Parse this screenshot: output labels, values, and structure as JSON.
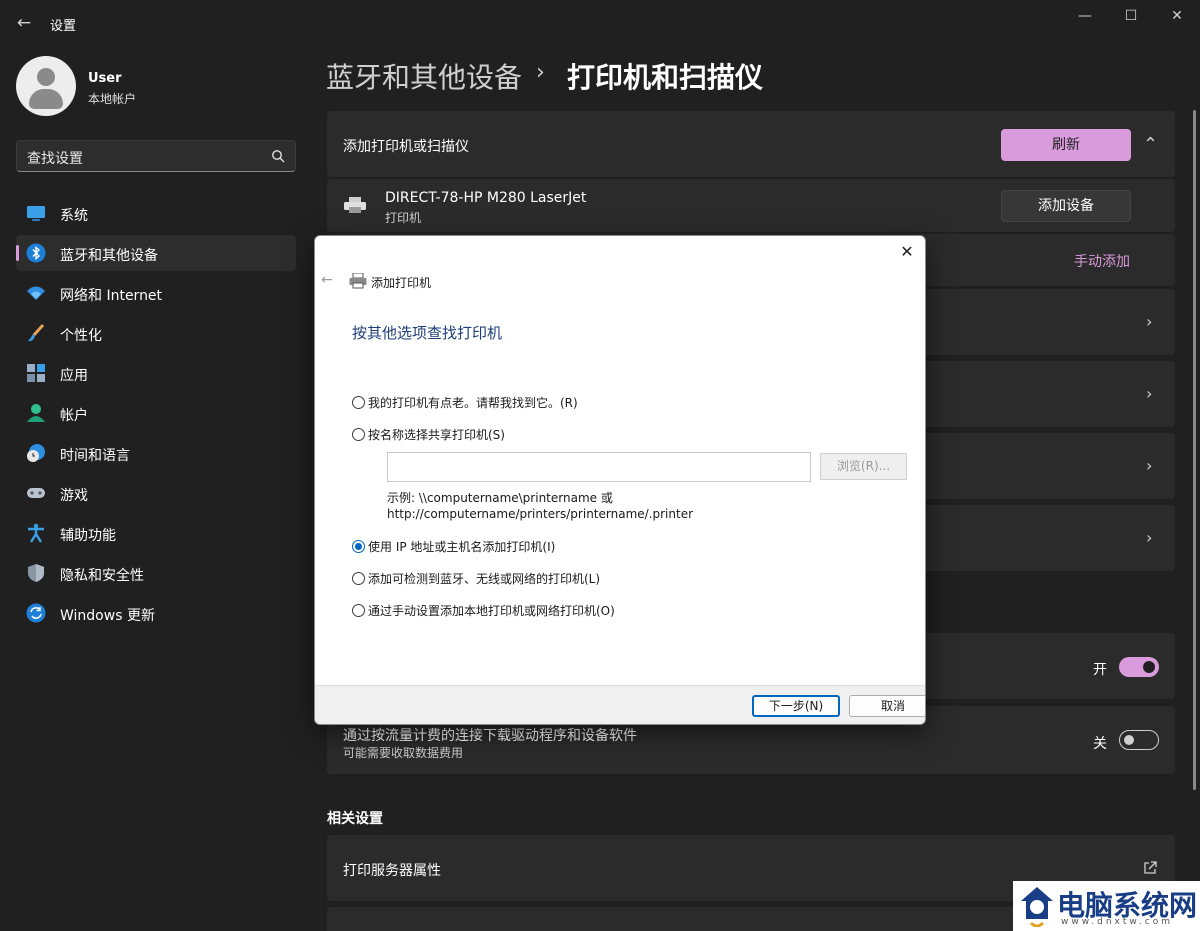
{
  "window": {
    "title": "设置",
    "back_glyph": "←",
    "minimize_glyph": "—",
    "maximize_glyph": "☐",
    "close_glyph": "✕"
  },
  "user": {
    "name": "User",
    "account_type": "本地帐户"
  },
  "search": {
    "value": "查找设置",
    "icon": "search-icon"
  },
  "sidebar": {
    "accent": "#d99bdc",
    "items": [
      {
        "label": "系统",
        "icon": "monitor-icon"
      },
      {
        "label": "蓝牙和其他设备",
        "icon": "bluetooth-icon",
        "active": true
      },
      {
        "label": "网络和 Internet",
        "icon": "wifi-icon"
      },
      {
        "label": "个性化",
        "icon": "brush-icon"
      },
      {
        "label": "应用",
        "icon": "apps-icon"
      },
      {
        "label": "帐户",
        "icon": "account-icon"
      },
      {
        "label": "时间和语言",
        "icon": "globe-clock-icon"
      },
      {
        "label": "游戏",
        "icon": "gamepad-icon"
      },
      {
        "label": "辅助功能",
        "icon": "accessibility-icon"
      },
      {
        "label": "隐私和安全性",
        "icon": "shield-icon"
      },
      {
        "label": "Windows 更新",
        "icon": "update-icon"
      }
    ]
  },
  "breadcrumb": {
    "parent": "蓝牙和其他设备",
    "separator": "›",
    "current": "打印机和扫描仪"
  },
  "main": {
    "add_section": {
      "title": "添加打印机或扫描仪",
      "refresh_label": "刷新",
      "collapse_glyph": "⌃"
    },
    "device": {
      "name": "DIRECT-78-HP M280 LaserJet",
      "type": "打印机",
      "add_label": "添加设备",
      "icon": "printer-icon"
    },
    "manual_add_label": "手动添加",
    "chevron_glyph": "›",
    "toggle_on": {
      "state_label": "开",
      "on": true
    },
    "metered": {
      "title": "通过按流量计费的连接下载驱动程序和设备软件",
      "subtitle": "可能需要收取数据费用",
      "state_label": "关",
      "on": false
    },
    "related": {
      "title": "相关设置",
      "print_server_label": "打印服务器属性",
      "external_icon": "external-link-icon"
    }
  },
  "dialog": {
    "title": "添加打印机",
    "heading": "按其他选项查找打印机",
    "close_glyph": "✕",
    "back_glyph": "←",
    "options": [
      {
        "label": "我的打印机有点老。请帮我找到它。(R)",
        "checked": false
      },
      {
        "label": "按名称选择共享打印机(S)",
        "checked": false
      },
      {
        "label": "使用 IP 地址或主机名添加打印机(I)",
        "checked": true
      },
      {
        "label": "添加可检测到蓝牙、无线或网络的打印机(L)",
        "checked": false
      },
      {
        "label": "通过手动设置添加本地打印机或网络打印机(O)",
        "checked": false
      }
    ],
    "share_input_value": "",
    "browse_label": "浏览(R)...",
    "example_line1": "示例: \\\\computername\\printername 或",
    "example_line2": "http://computername/printers/printername/.printer",
    "next_label": "下一步(N)",
    "cancel_label": "取消"
  },
  "watermark": {
    "text": "电脑系统网",
    "url": "www.dnxtw.com"
  }
}
